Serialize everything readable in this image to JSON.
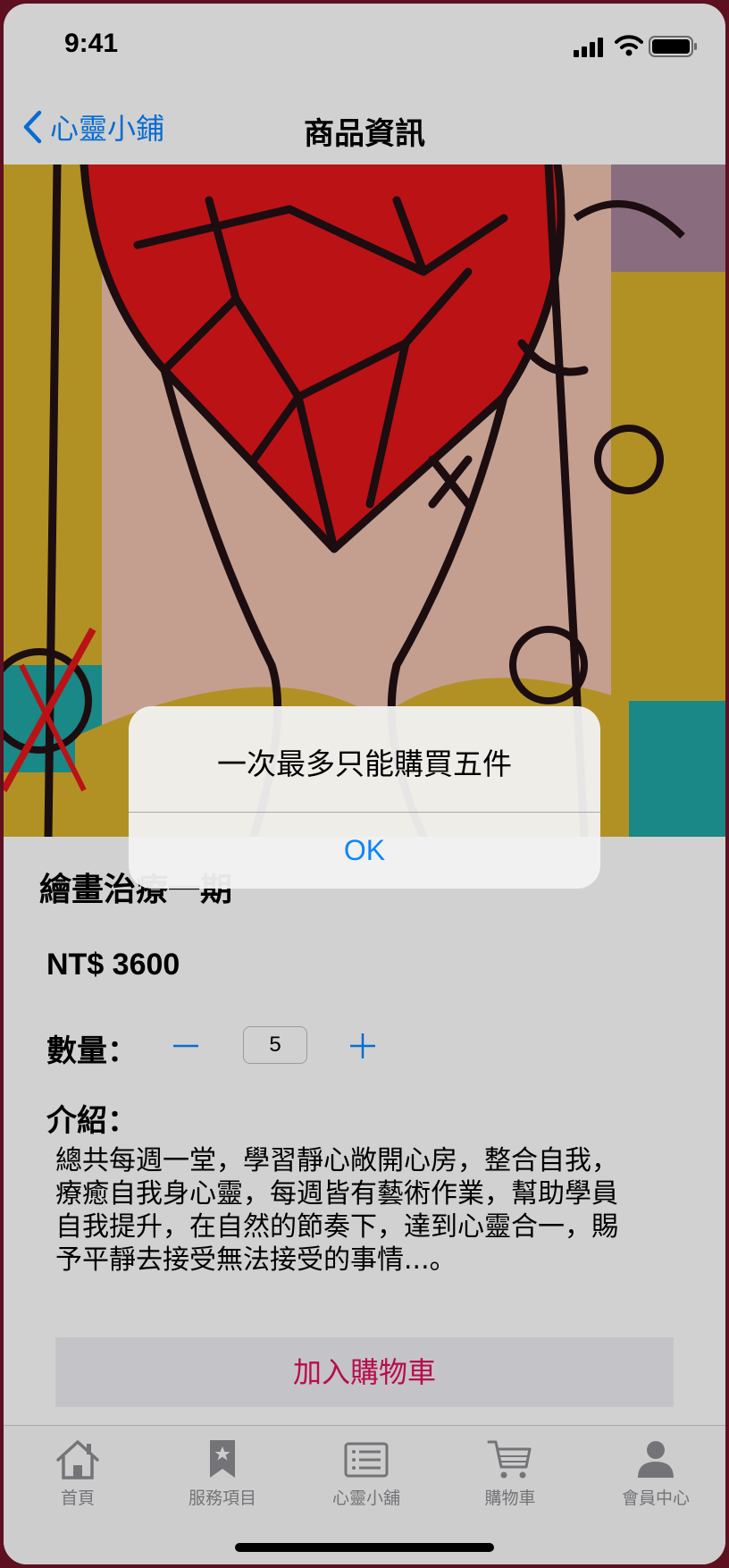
{
  "status_bar": {
    "time": "9:41"
  },
  "nav": {
    "back_label": "心靈小鋪",
    "title": "商品資訊"
  },
  "product": {
    "name": "繪畫治療一期",
    "price": "NT$ 3600",
    "quantity_label": "數量：",
    "quantity": "5",
    "intro_label": "介紹：",
    "intro_lines": [
      "總共每週一堂，學習靜心敞開心房，整合自我，",
      "療癒自我身心靈，每週皆有藝術作業，幫助學員",
      "自我提升，在自然的節奏下，達到心靈合一，賜",
      "予平靜去接受無法接受的事情...。"
    ],
    "add_to_cart": "加入購物車"
  },
  "tabs": [
    {
      "label": "首頁",
      "icon": "home-icon"
    },
    {
      "label": "服務項目",
      "icon": "bookmark-icon"
    },
    {
      "label": "心靈小舖",
      "icon": "list-icon"
    },
    {
      "label": "購物車",
      "icon": "cart-icon"
    },
    {
      "label": "會員中心",
      "icon": "person-icon"
    }
  ],
  "alert": {
    "message": "一次最多只能購買五件",
    "ok_label": "OK"
  },
  "colors": {
    "accent": "#0a84ff",
    "cart_button_text": "#e0115f",
    "tab_inactive": "#8e8e93"
  }
}
